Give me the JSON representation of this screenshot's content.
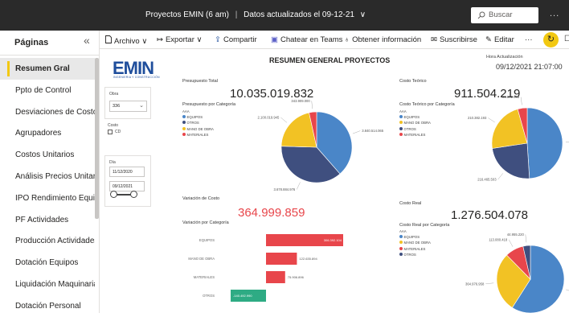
{
  "topbar": {
    "report_name": "Proyectos EMIN (6 am)",
    "separator": "|",
    "data_updated": "Datos actualizados el 09-12-21",
    "data_updated_chevron": "∨",
    "search_placeholder": "Buscar",
    "more": "..."
  },
  "sidebar": {
    "header": "Páginas",
    "collapse_icon": "chevron-double-left-icon",
    "collapse_glyph": "«",
    "items": [
      {
        "label": "Resumen Gral",
        "active": true
      },
      {
        "label": "Ppto de Control"
      },
      {
        "label": "Desviaciones de Costo"
      },
      {
        "label": "Agrupadores"
      },
      {
        "label": "Costos Unitarios"
      },
      {
        "label": "Análisis Precios Unitar..."
      },
      {
        "label": "IPO Rendimiento Equi..."
      },
      {
        "label": "PF Actividades"
      },
      {
        "label": "Producción Actividades"
      },
      {
        "label": "Dotación Equipos"
      },
      {
        "label": "Liquidación Maquinaria"
      },
      {
        "label": "Dotación Personal"
      }
    ]
  },
  "toolbar": {
    "archivo": "Archivo",
    "exportar": "Exportar",
    "compartir": "Compartir",
    "chatear": "Chatear en Teams",
    "obtener": "Obtener información",
    "suscribirse": "Suscribirse",
    "editar": "Editar",
    "more": "···"
  },
  "report": {
    "logo_text": "EMIN",
    "logo_sub": "INGENIERIA Y CONSTRUCCIÓN",
    "title": "RESUMEN GENERAL PROYECTOS",
    "update_label": "Hora Actualización",
    "update_value": "09/12/2021 21:07:00"
  },
  "filters": {
    "obra_label": "Obra",
    "obra_value": "336",
    "costo_label": "Costo",
    "cd_label": "CD",
    "dia_label": "Día",
    "date_from": "11/12/2020",
    "date_to": "09/12/2021"
  },
  "kpis": {
    "presupuesto_total_label": "Presupuesto Total",
    "presupuesto_total": "10.035.019.832",
    "costo_teorico_label": "Costo Teórico",
    "costo_teorico": "911.504.219",
    "variacion_label": "Variación de Costo",
    "variacion": "364.999.859",
    "costo_real_label": "Costo Real",
    "costo_real": "1.276.504.078"
  },
  "colors": {
    "equipos": "#4a86c8",
    "mano_obra": "#f2c224",
    "otros": "#3f4f7f",
    "materiales": "#e8464b",
    "negative": "#2eab84",
    "accent": "#f2c811"
  },
  "chart_data": [
    {
      "type": "pie",
      "title": "Presupuesto por Categoría",
      "legend_title": "AAA",
      "legend": [
        "EQUIPOS",
        "OTROS",
        "MANO DE OBRA",
        "MATERIALES"
      ],
      "labels": [
        "EQUIPOS",
        "OTROS",
        "MANO DE OBRA",
        "MATERIALES"
      ],
      "values": [
        3840514065,
        3678884976,
        2100019945,
        343909000
      ],
      "data_labels": [
        "3.840.514.065",
        "3.678.884.976",
        "2.100.019.945",
        "343.909.000"
      ]
    },
    {
      "type": "pie",
      "title": "Costo Teórico por Categoría",
      "legend_title": "AAA",
      "legend": [
        "EQUIPOS",
        "MANO DE OBRA",
        "OTROS",
        "MATERIALES"
      ],
      "labels": [
        "EQUIPOS",
        "OTROS",
        "MANO DE OBRA",
        "MATERIALES"
      ],
      "values": [
        448130941,
        216465503,
        210382193,
        39872943
      ],
      "data_labels": [
        "448.130.941",
        "216.465.503",
        "210.382.193",
        "39.872.943"
      ]
    },
    {
      "type": "bar",
      "orientation": "horizontal",
      "title": "Variación por Categoría",
      "categories": [
        "EQUIPOS",
        "MANO DE OBRA",
        "MATERIALES",
        "OTROS"
      ],
      "values": [
        306392104,
        122635894,
        75906896,
        -140492990
      ],
      "data_labels": [
        "306.392.104",
        "122.635.894",
        "75.906.896",
        "-140.492.990"
      ]
    },
    {
      "type": "pie",
      "title": "Costo Real por Categoría",
      "legend_title": "AAA",
      "legend": [
        "EQUIPOS",
        "MANO DE OBRA",
        "MATERIALES",
        "OTROS"
      ],
      "labels": [
        "EQUIPOS",
        "MANO DE OBRA",
        "MATERIALES",
        "OTROS"
      ],
      "values": [
        754611292,
        364976958,
        113080418,
        44955220
      ],
      "data_labels": [
        "754.611.292",
        "364.976.958",
        "113.080.418",
        "44.955.220"
      ]
    }
  ]
}
